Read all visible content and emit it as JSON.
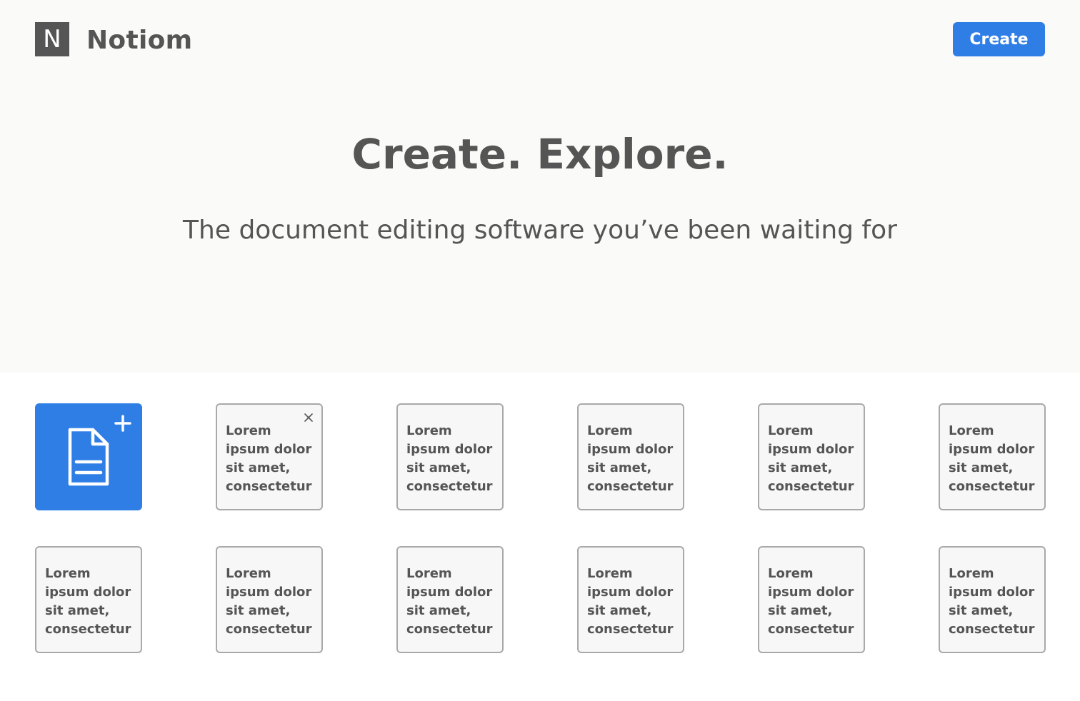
{
  "header": {
    "logo_letter": "N",
    "brand_name": "Notiom",
    "create_label": "Create"
  },
  "hero": {
    "headline": "Create. Explore.",
    "tagline": "The document editing software you’ve been waiting for"
  },
  "colors": {
    "accent": "#2f7ee6",
    "text": "#555555",
    "hero_background": "#fafaf8",
    "card_border": "#a9a9a9"
  },
  "new_document": {
    "icons": [
      "document-icon",
      "plus-icon"
    ]
  },
  "documents": [
    {
      "text": "Lorem\nipsum dolor\nsit amet,\nconsectetur",
      "has_close": true
    },
    {
      "text": "Lorem\nipsum dolor\nsit amet,\nconsectetur",
      "has_close": false
    },
    {
      "text": "Lorem\nipsum dolor\nsit amet,\nconsectetur",
      "has_close": false
    },
    {
      "text": "Lorem\nipsum dolor\nsit amet,\nconsectetur",
      "has_close": false
    },
    {
      "text": "Lorem\nipsum dolor\nsit amet,\nconsectetur",
      "has_close": false
    },
    {
      "text": "Lorem\nipsum dolor\nsit amet,\nconsectetur",
      "has_close": false
    },
    {
      "text": "Lorem\nipsum dolor\nsit amet,\nconsectetur",
      "has_close": false
    },
    {
      "text": "Lorem\nipsum dolor\nsit amet,\nconsectetur",
      "has_close": false
    },
    {
      "text": "Lorem\nipsum dolor\nsit amet,\nconsectetur",
      "has_close": false
    },
    {
      "text": "Lorem\nipsum dolor\nsit amet,\nconsectetur",
      "has_close": false
    },
    {
      "text": "Lorem\nipsum dolor\nsit amet,\nconsectetur",
      "has_close": false
    }
  ]
}
